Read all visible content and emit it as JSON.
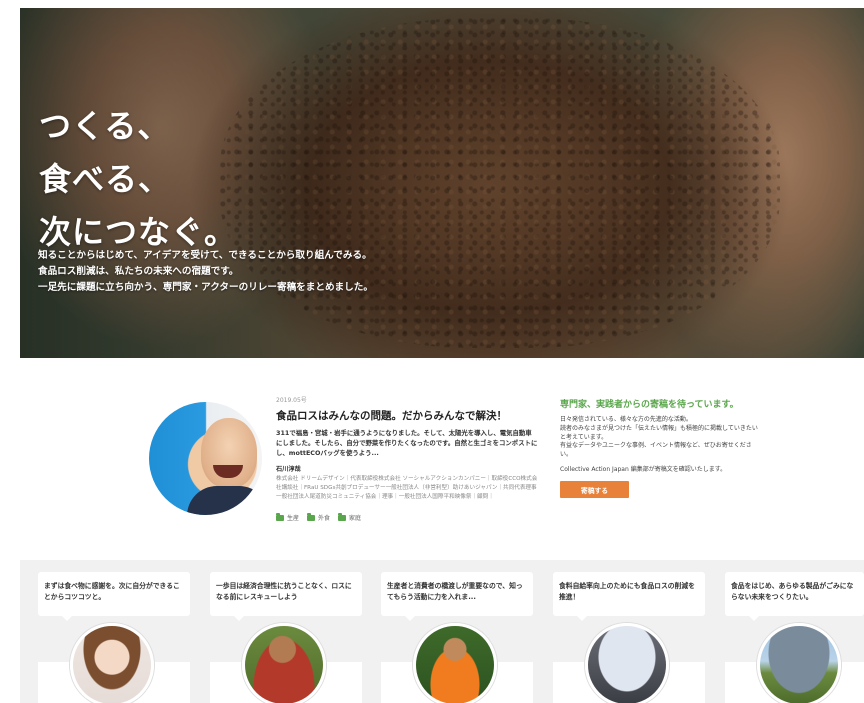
{
  "hero": {
    "title_lines": [
      "つくる、",
      "食べる、",
      "次につなぐ。"
    ],
    "lead_lines": [
      "知ることからはじめて、アイデアを受けて、できることから取り組んでみる。",
      "食品ロス削減は、私たちの未来への宿題です。",
      "一足先に課題に立ち向かう、専門家・アクターのリレー寄稿をまとめました。"
    ]
  },
  "feature": {
    "date": "2019.05号",
    "title": "食品ロスはみんなの問題。だからみんなで解決！",
    "excerpt": "311で福島・宮城・岩手に通うようになりました。そして、太陽光を導入し、電気自動車にしました。そしたら、自分で野菜を作りたくなったのです。自然と生ゴミをコンポストにし、mottECOバッグを使うよう...",
    "author": "石川淳哉",
    "affiliation": "株式会社 ドリームデザイン｜代表取締役株式会社 ソーシャルアクションカンパニー｜取締役CCO株式会社講談社｜FRaU SDGs共創プロデューサー一般社団法人（非営利型）助けあいジャパン｜共同代表理事一般社団法人尾道防災コミュニティ協会｜理事｜一般社団法人国際平和映像祭｜顧問｜",
    "tags": [
      "生産",
      "外食",
      "家庭"
    ]
  },
  "cta": {
    "title": "専門家、実践者からの寄稿を待っています。",
    "text_lines": [
      "日々発信されている、様々な方の先進的な活動。",
      "読者のみなさまが見つけた「伝えたい情報」も積極的に掲載していきたいと考えています。",
      "有益なデータやユニークな事例、イベント情報など、ぜひお寄せください。"
    ],
    "sub": "Collective Action Japan 編集部が寄稿文を確認いたします。",
    "button_label": "寄稿する"
  },
  "cards": [
    {
      "caption": "まずは食べ物に感謝を。次に自分ができることからコツコツと。"
    },
    {
      "caption": "一歩目は経済合理性に抗うことなく、ロスになる前にレスキューしよう"
    },
    {
      "caption": "生産者と消費者の橋渡しが重要なので、知ってもらう活動に力を入れま..."
    },
    {
      "caption": "食料自給率向上のためにも食品ロスの削減を推進！"
    },
    {
      "caption": "食品をはじめ、あらゆる製品がごみにならない未来をつくりたい。"
    }
  ],
  "colors": {
    "accent_green": "#5aa64c",
    "cta_orange": "#e8823a"
  }
}
